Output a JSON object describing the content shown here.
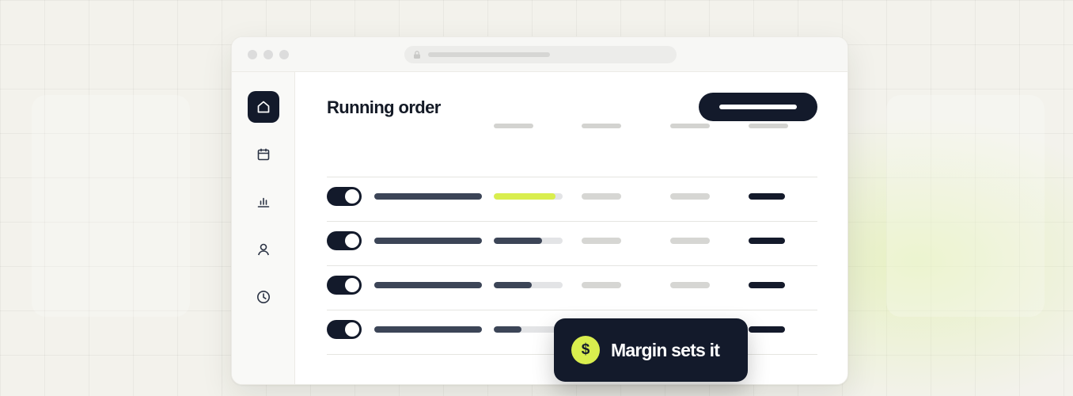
{
  "main": {
    "title": "Running order"
  },
  "sidebar": {
    "items": [
      {
        "icon": "home-icon",
        "active": true
      },
      {
        "icon": "calendar-icon",
        "active": false
      },
      {
        "icon": "bar-chart-icon",
        "active": false
      },
      {
        "icon": "user-icon",
        "active": false
      },
      {
        "icon": "clock-icon",
        "active": false
      }
    ]
  },
  "table": {
    "rows": [
      {
        "enabled": true,
        "progress": 0.9,
        "highlight": true
      },
      {
        "enabled": true,
        "progress": 0.7,
        "highlight": false
      },
      {
        "enabled": true,
        "progress": 0.55,
        "highlight": false
      },
      {
        "enabled": true,
        "progress": 0.4,
        "highlight": false
      }
    ]
  },
  "toast": {
    "icon": "dollar-icon",
    "symbol": "$",
    "message": "Margin sets it"
  },
  "colors": {
    "dark": "#131a2b",
    "accent": "#d9ee4e",
    "background": "#f3f2ec"
  }
}
